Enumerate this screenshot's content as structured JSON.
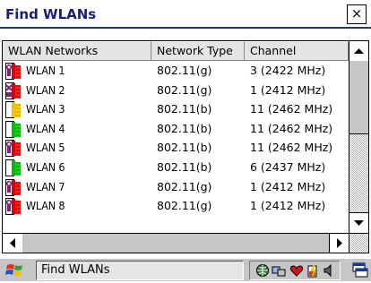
{
  "window": {
    "title": "Find WLANs",
    "close_label": "×"
  },
  "columns": [
    "WLAN Networks",
    "Network Type",
    "Channel"
  ],
  "rows": [
    {
      "icon": "wlan-secured-red-signal-icon",
      "name": "WLAN 1",
      "type": "802.11(g)",
      "channel": "3 (2422 MHz)"
    },
    {
      "icon": "wlan-adhoc-red-signal-icon",
      "name": "WLAN 2",
      "type": "802.11(g)",
      "channel": "1 (2412 MHz)"
    },
    {
      "icon": "wlan-yellow-signal-icon",
      "name": "WLAN 3",
      "type": "802.11(b)",
      "channel": "11 (2462 MHz)"
    },
    {
      "icon": "wlan-green-signal-icon",
      "name": "WLAN 4",
      "type": "802.11(b)",
      "channel": "11 (2462 MHz)"
    },
    {
      "icon": "wlan-secured-green-signal-icon",
      "name": "WLAN 5",
      "type": "802.11(b)",
      "channel": "11 (2462 MHz)"
    },
    {
      "icon": "wlan-green-signal-icon",
      "name": "WLAN 6",
      "type": "802.11(b)",
      "channel": "6 (2437 MHz)"
    },
    {
      "icon": "wlan-secured-green-signal-icon",
      "name": "WLAN 7",
      "type": "802.11(g)",
      "channel": "1 (2412 MHz)"
    },
    {
      "icon": "wlan-secured-green-signal-icon",
      "name": "WLAN 8",
      "type": "802.11(g)",
      "channel": "1 (2412 MHz)"
    }
  ],
  "taskbar": {
    "active_task": "Find WLANs"
  },
  "colors": {
    "title_text": "#1b1b7e",
    "signal_green": "#00c000",
    "signal_yellow": "#f2c200",
    "signal_red": "#e00000",
    "lock_blue": "#1a8fd8",
    "taskbar": "#c6c6c6"
  }
}
